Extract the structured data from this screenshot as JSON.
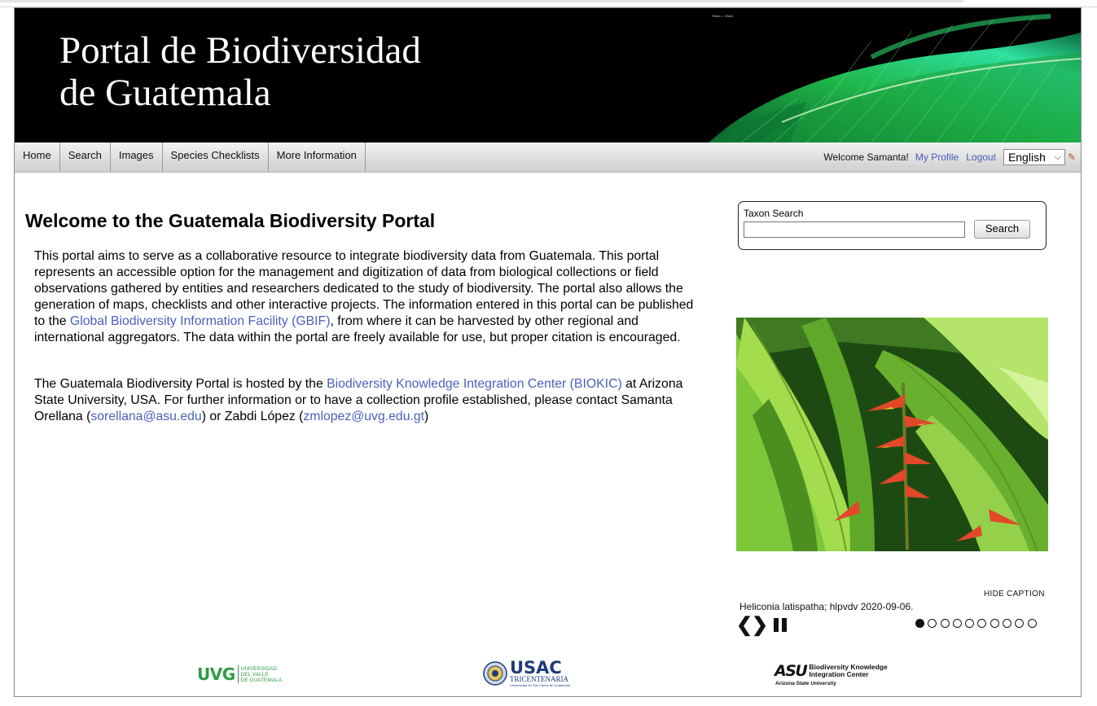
{
  "banner": {
    "title_line1": "Portal de Biodiversidad",
    "title_line2": "de Guatemala",
    "photo_credit": "Hilton L. Olsen"
  },
  "nav": {
    "items": [
      "Home",
      "Search",
      "Images",
      "Species Checklists",
      "More Information"
    ]
  },
  "user": {
    "welcome": "Welcome Samanta!",
    "profile": "My Profile",
    "logout": "Logout",
    "language": "English"
  },
  "main": {
    "heading": "Welcome to the Guatemala Biodiversity Portal",
    "p1_a": "This portal aims to serve as a collaborative resource to integrate biodiversity data from Guatemala. This portal represents an accessible option for the management and digitization of data from biological collections or field observations gathered by entities and researchers dedicated to the study of biodiversity. The portal also allows the generation of maps, checklists and other interactive projects. The information entered in this portal can be published to the ",
    "p1_link": "Global Biodiversity Information Facility (GBIF)",
    "p1_b": ", from where it can be harvested by other regional and international aggregators. The data within the portal are freely available for use, but proper citation is encouraged.",
    "p2_a": "The Guatemala Biodiversity Portal is hosted by the ",
    "p2_link": "Biodiversity Knowledge Integration Center (BIOKIC)",
    "p2_b": " at Arizona State University, USA. For further information or to have a collection profile established, please contact Samanta Orellana (",
    "p2_email1": "sorellana@asu.edu",
    "p2_c": ") or Zabdi López (",
    "p2_email2": "zmlopez@uvg.edu.gt",
    "p2_d": ")"
  },
  "taxon_search": {
    "label": "Taxon Search",
    "value": "",
    "button": "Search"
  },
  "slideshow": {
    "hide_caption": "HIDE CAPTION",
    "caption": "Heliconia latispatha; hlpvdv 2020-09-06.",
    "prev": "❮",
    "next": "❯",
    "slides_total": 10,
    "current_slide": 1
  },
  "logos": {
    "uvg": {
      "mark": "UVG",
      "line1": "UNIVERSIDAD",
      "line2": "DEL VALLE",
      "line3": "DE GUATEMALA"
    },
    "usac": {
      "mark": "USAC",
      "line1": "TRICENTENARIA",
      "line2": "Universidad de San Carlos de Guatemala"
    },
    "asu": {
      "mark": "ASU",
      "line1": "Biodiversity Knowledge",
      "line2": "Integration Center",
      "line3": "Arizona State University"
    }
  },
  "colors": {
    "link": "#4b5fbd",
    "banner_bg": "#000000",
    "logo_green": "#2e9b45",
    "logo_blue": "#1f3b78"
  },
  "icons": [
    "pencil-icon",
    "chevron-down-icon",
    "prev-arrow-icon",
    "next-arrow-icon",
    "pause-icon"
  ]
}
